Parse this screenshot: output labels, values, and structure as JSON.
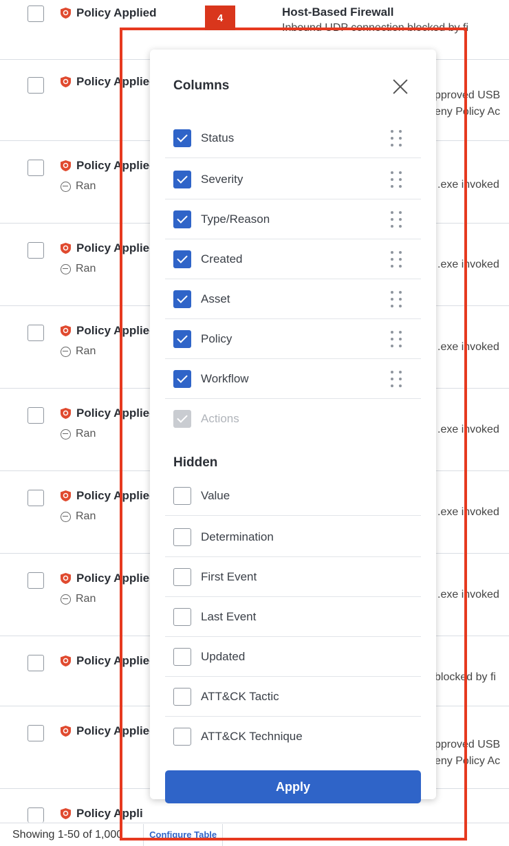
{
  "table": {
    "rows": [
      {
        "status": "Policy Applied",
        "sub_status": "",
        "right_title": "Host-Based Firewall",
        "right_sub": "Inbound UDP connection blocked by fi"
      },
      {
        "status": "Policy Applied",
        "sub_status": "",
        "right_title": "",
        "right_sub": "pproved USB",
        "right_sub2": "eny Policy Ac"
      },
      {
        "status": "Policy Applied",
        "sub_status": "Ran",
        "right_title": "",
        "right_sub": ".exe invoked"
      },
      {
        "status": "Policy Applied",
        "sub_status": "Ran",
        "right_title": "",
        "right_sub": ".exe invoked"
      },
      {
        "status": "Policy Applied",
        "sub_status": "Ran",
        "right_title": "",
        "right_sub": ".exe invoked"
      },
      {
        "status": "Policy Applied",
        "sub_status": "Ran",
        "right_title": "",
        "right_sub": ".exe invoked"
      },
      {
        "status": "Policy Applied",
        "sub_status": "Ran",
        "right_title": "",
        "right_sub": ".exe invoked"
      },
      {
        "status": "Policy Applied",
        "sub_status": "Ran",
        "right_title": "",
        "right_sub": ".exe invoked"
      },
      {
        "status": "Policy Applied",
        "sub_status": "",
        "right_title": "",
        "right_sub": "blocked by fi"
      },
      {
        "status": "Policy Applied",
        "sub_status": "",
        "right_title": "",
        "right_sub": "pproved USB",
        "right_sub2": "eny Policy Ac"
      },
      {
        "status": "Policy Appli",
        "sub_status": "",
        "right_title": "",
        "right_sub": ""
      }
    ]
  },
  "footer": {
    "count_text": "Showing 1-50 of 1,000",
    "configure_label": "Configure Table"
  },
  "annotation": {
    "badge": "4",
    "color": "#e6391f"
  },
  "panel": {
    "title": "Columns",
    "hidden_title": "Hidden",
    "apply_label": "Apply",
    "visible_columns": [
      {
        "label": "Status",
        "checked": true
      },
      {
        "label": "Severity",
        "checked": true
      },
      {
        "label": "Type/Reason",
        "checked": true
      },
      {
        "label": "Created",
        "checked": true
      },
      {
        "label": "Asset",
        "checked": true
      },
      {
        "label": "Policy",
        "checked": true
      },
      {
        "label": "Workflow",
        "checked": true
      },
      {
        "label": "Actions",
        "checked": true,
        "disabled": true
      }
    ],
    "hidden_columns": [
      {
        "label": "Value",
        "checked": false
      },
      {
        "label": "Determination",
        "checked": false
      },
      {
        "label": "First Event",
        "checked": false
      },
      {
        "label": "Last Event",
        "checked": false
      },
      {
        "label": "Updated",
        "checked": false
      },
      {
        "label": "ATT&CK Tactic",
        "checked": false
      },
      {
        "label": "ATT&CK Technique",
        "checked": false
      }
    ]
  },
  "colors": {
    "accent": "#2f64c8",
    "status_red": "#e04a2f",
    "annotation": "#e6391f"
  }
}
